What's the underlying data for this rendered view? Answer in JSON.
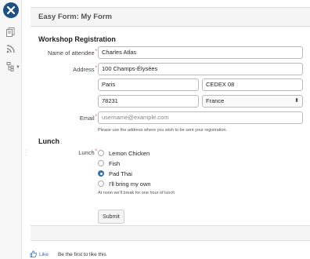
{
  "sidebar": {
    "logo_icon": "confluence-logo-icon",
    "items": [
      {
        "icon": "pages-icon"
      },
      {
        "icon": "rss-feed-icon"
      },
      {
        "icon": "page-tree-icon"
      }
    ]
  },
  "panel": {
    "title": "Easy Form: My Form"
  },
  "form": {
    "section_registration": "Workshop Registration",
    "name_label": "Name of attendee",
    "name_value": "Charles Atlas",
    "address_label": "Address",
    "street_value": "100 Champs-Élysées",
    "city_value": "Paris",
    "cedex_value": "CEDEX 08",
    "postcode_value": "78231",
    "country_value": "France",
    "email_label": "Email",
    "email_placeholder": "username@example.com",
    "email_help": "Please use the address where you wish to be sent your registration.",
    "section_lunch": "Lunch",
    "lunch_label": "Lunch",
    "lunch_options": [
      {
        "label": "Lemon Chicken",
        "checked": false
      },
      {
        "label": "Fish",
        "checked": false
      },
      {
        "label": "Pad Thai",
        "checked": true
      },
      {
        "label": "I'll bring my own",
        "checked": false
      }
    ],
    "lunch_help": "At noon we'll break for one hour of lunch",
    "submit_label": "Submit"
  },
  "footer": {
    "like_label": "Like",
    "like_text": "Be the first to like this"
  },
  "colors": {
    "accent": "#3572b0",
    "required": "#d04437",
    "logo_bg": "#205081"
  }
}
